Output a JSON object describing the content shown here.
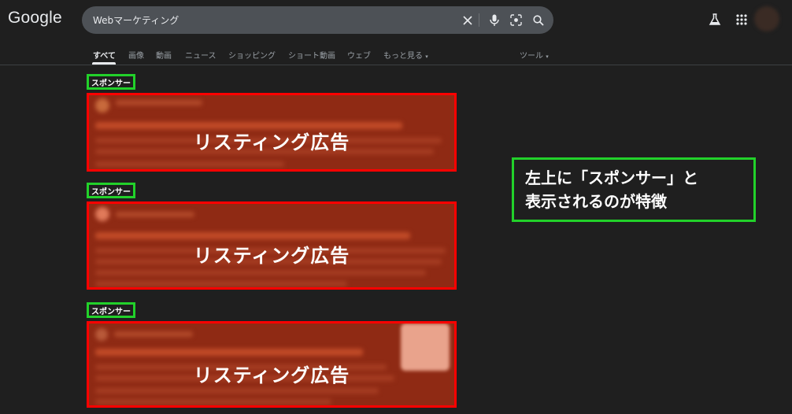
{
  "header": {
    "logo": "Google",
    "search_query": "Webマーケティング",
    "icons": [
      "close-icon",
      "mic-icon",
      "lens-icon",
      "search-icon",
      "labs-flask-icon",
      "apps-grid-icon"
    ]
  },
  "tabs": {
    "items": [
      "すべて",
      "画像",
      "動画",
      "ニュース",
      "ショッピング",
      "ショート動画",
      "ウェブ",
      "もっと見る"
    ],
    "tools": "ツール"
  },
  "ads": [
    {
      "sponsor": "スポンサー",
      "label": "リスティング広告"
    },
    {
      "sponsor": "スポンサー",
      "label": "リスティング広告"
    },
    {
      "sponsor": "スポンサー",
      "label": "リスティング広告"
    }
  ],
  "callout": {
    "line1": "左上に「スポンサー」と",
    "line2": "表示されるのが特徴"
  },
  "colors": {
    "background": "#1f1f1f",
    "highlight_green": "#22d12a",
    "highlight_red": "#ff0000",
    "ad_fill": "#8f2a14"
  }
}
